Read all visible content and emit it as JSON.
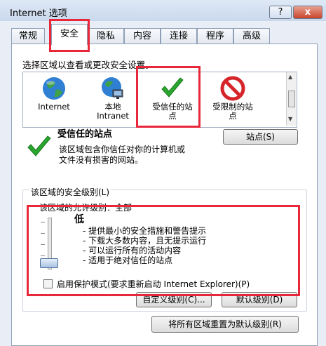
{
  "window": {
    "title": "Internet 选项",
    "help_label": "?",
    "close_label": "x"
  },
  "tabs": [
    {
      "label": "常规"
    },
    {
      "label": "安全"
    },
    {
      "label": "隐私"
    },
    {
      "label": "内容"
    },
    {
      "label": "连接"
    },
    {
      "label": "程序"
    },
    {
      "label": "高级"
    }
  ],
  "active_tab": "安全",
  "zones": {
    "prompt": "选择区域以查看或更改安全设置。",
    "items": [
      {
        "label_line1": "Internet",
        "label_line2": "",
        "icon": "globe-icon"
      },
      {
        "label_line1": "本地",
        "label_line2": "Intranet",
        "icon": "intranet-globe-icon"
      },
      {
        "label_line1": "受信任的站",
        "label_line2": "点",
        "icon": "checkmark-icon"
      },
      {
        "label_line1": "受限制的站",
        "label_line2": "点",
        "icon": "restricted-icon"
      }
    ],
    "selected": "受信任的站点"
  },
  "zone_detail": {
    "title": "受信任的站点",
    "sites_button": "站点(S)",
    "description_line1": "该区域包含你信任对你的计算机或",
    "description_line2": "文件没有损害的网站。"
  },
  "security_level": {
    "group_label": "该区域的安全级别(L)",
    "allowed_levels": "该区域的允许级别：全部",
    "level_name": "低",
    "items": [
      "- 提供最小的安全措施和警告提示",
      "- 下载大多数内容，且无提示运行",
      "- 可以运行所有的活动内容",
      "- 适用于绝对信任的站点"
    ],
    "protected_mode_label": "启用保护模式(要求重新启动 Internet Explorer)(P)",
    "protected_mode_checked": false,
    "custom_button": "自定义级别(C)...",
    "default_button": "默认级别(D)",
    "reset_button": "将所有区域重置为默认级别(R)"
  },
  "colors": {
    "annotation_red": "#e8283a",
    "check_green": "#2aa52e",
    "restricted_red": "#d6252a"
  }
}
